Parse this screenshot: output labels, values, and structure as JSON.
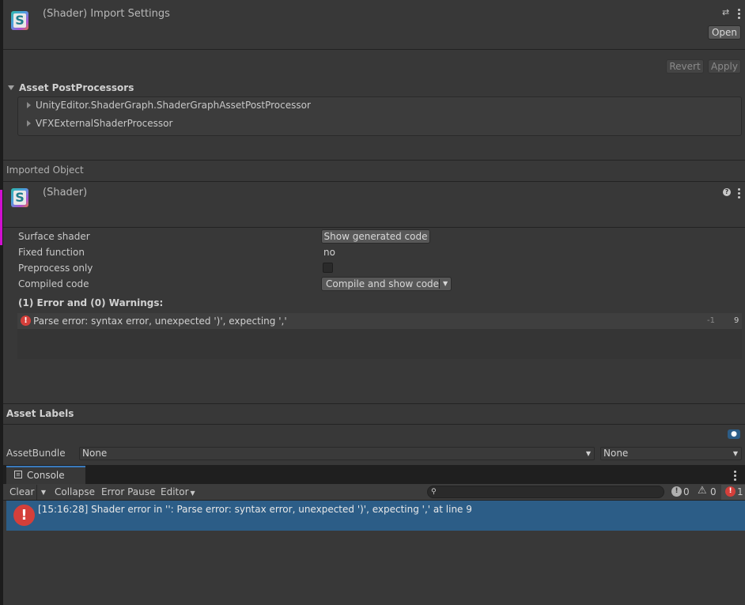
{
  "header": {
    "title": "(Shader) Import Settings",
    "open_label": "Open",
    "revert_label": "Revert",
    "apply_label": "Apply",
    "icon_letter": "S"
  },
  "postprocessors": {
    "title": "Asset PostProcessors",
    "items": [
      "UnityEditor.ShaderGraph.ShaderGraphAssetPostProcessor",
      "VFXExternalShaderProcessor"
    ]
  },
  "imported": {
    "section_label": "Imported Object",
    "title": "(Shader)",
    "icon_letter": "S"
  },
  "props": {
    "surface_label": "Surface shader",
    "surface_button": "Show generated code",
    "fixed_label": "Fixed function",
    "fixed_value": "no",
    "preprocess_label": "Preprocess only",
    "preprocess_checked": false,
    "compiled_label": "Compiled code",
    "compiled_button": "Compile and show code",
    "errors_heading": "(1) Error and (0) Warnings:",
    "error_message": "Parse error: syntax error, unexpected ')', expecting ','",
    "error_col": "-1",
    "error_line": "9"
  },
  "labels": {
    "title": "Asset Labels",
    "bundle_label": "AssetBundle",
    "bundle_value": "None",
    "variant_value": "None"
  },
  "console": {
    "tab_label": "Console",
    "clear_label": "Clear",
    "collapse_label": "Collapse",
    "error_pause_label": "Error Pause",
    "editor_label": "Editor",
    "search_placeholder": "",
    "info_count": "0",
    "warn_count": "0",
    "error_count": "1",
    "log_entry": "[15:16:28] Shader error in '': Parse error: syntax error, unexpected ')', expecting ',' at line 9"
  },
  "colors": {
    "accent_selected": "#2c5d87",
    "error_red": "#d43f3a",
    "panel_bg": "#383838"
  }
}
